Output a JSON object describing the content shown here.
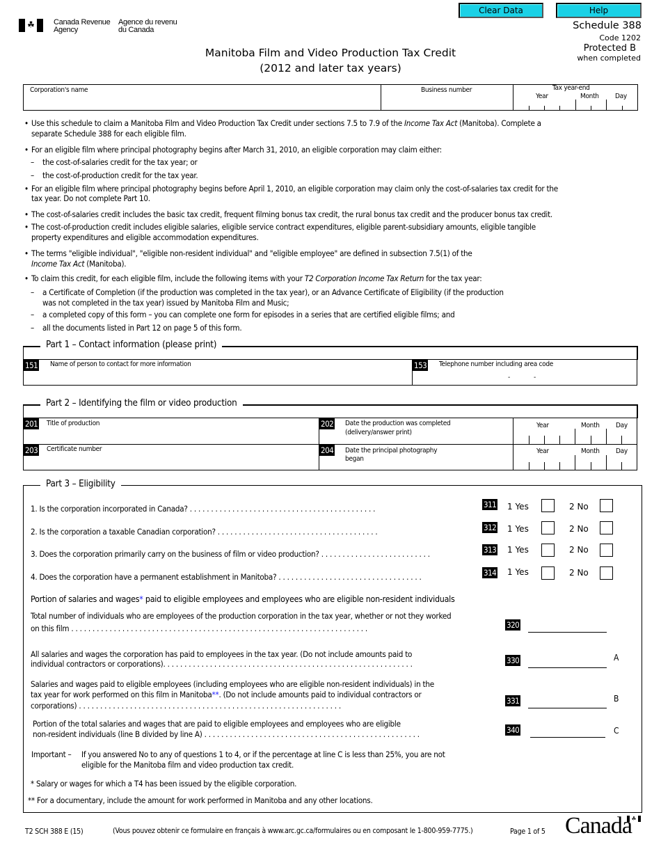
{
  "header": {
    "buttons": {
      "clear_data": "Clear Data",
      "help": "Help"
    },
    "agency_en": [
      "Canada Revenue",
      "Agency"
    ],
    "agency_fr": [
      "Agence du revenu",
      "du Canada"
    ],
    "flag_icon": "canada-flag-icon",
    "title": "Manitoba Film and Video Production Tax Credit",
    "subtitle": "(2012 and later tax years)",
    "schedule": "Schedule 388",
    "code": "Code 1202",
    "protected": "Protected B",
    "protected_note": "when completed"
  },
  "identification": {
    "corporation_name_label": "Corporation's name",
    "corporation_name_value": "",
    "business_number_label": "Business number",
    "business_number_value": "",
    "tax_year_end_label": "Tax year-end",
    "year_label": "Year",
    "month_label": "Month",
    "day_label": "Day"
  },
  "instructions": [
    {
      "type": "bullet",
      "lines": [
        "Use this schedule to claim a Manitoba Film and Video Production Tax Credit under sections 7.5 to 7.9 of the ",
        "Income Tax Act",
        " (Manitoba). Complete a",
        "separate Schedule 388 for each eligible film."
      ]
    },
    {
      "type": "bullet",
      "text": "For an eligible film where principal photography begins after March 31, 2010, an eligible corporation may claim either:"
    },
    {
      "type": "dash",
      "text": "the cost-of-salaries credit for the tax year; or"
    },
    {
      "type": "dash",
      "text": "the cost-of-production credit for the tax year."
    },
    {
      "type": "bullet",
      "lines": [
        "For an eligible film where principal photography begins before April 1, 2010, an eligible corporation may claim only the cost-of-salaries tax credit for the",
        "tax year. Do not complete Part 10."
      ]
    },
    {
      "type": "bullet",
      "text": "The cost-of-salaries credit includes the basic tax credit, frequent filming bonus tax credit, the rural bonus tax credit and the producer bonus tax credit."
    },
    {
      "type": "bullet",
      "lines": [
        "The cost-of-production credit includes eligible salaries, eligible service contract expenditures, eligible parent-subsidiary amounts, eligible tangible",
        "property expenditures and eligible accommodation expenditures."
      ]
    },
    {
      "type": "bullet",
      "lines": [
        "The terms \"eligible individual\", \"eligible non-resident individual\" and \"eligible employee\" are defined in subsection 7.5(1) of the",
        "Income Tax Act",
        " (Manitoba)."
      ]
    },
    {
      "type": "bullet",
      "lines": [
        "To claim this credit, for each eligible film, include the following items with your ",
        "T2 Corporation Income Tax Return",
        " for the tax year:"
      ]
    },
    {
      "type": "dash",
      "lines": [
        "a Certificate of Completion (if the production was completed in the tax year), or an Advance Certificate of Eligibility (if the production",
        "was not completed in the tax year) issued by Manitoba Film and Music;"
      ]
    },
    {
      "type": "dash",
      "text": "a completed copy of this form – you can complete one form for episodes in a series that are certified eligible films; and"
    },
    {
      "type": "dash",
      "text": "all the documents listed in Part 12 on page 5 of this form."
    }
  ],
  "part1": {
    "title": "Part 1 – Contact information (please print)",
    "fields": [
      {
        "code": "151",
        "label": "Name of person to contact for more information",
        "value": ""
      },
      {
        "code": "153",
        "label": "Telephone number including area code",
        "value": "",
        "separator": "-"
      }
    ]
  },
  "part2": {
    "title": "Part 2 – Identifying the film or video production",
    "fields": [
      {
        "code": "201",
        "label": "Title of production",
        "value": ""
      },
      {
        "code": "202",
        "label_lines": [
          "Date the production was completed",
          "(delivery/answer print)"
        ]
      },
      {
        "code": "203",
        "label": "Certificate number",
        "value": ""
      },
      {
        "code": "204",
        "label_lines": [
          "Date the principal photography",
          "began"
        ]
      }
    ],
    "year_label": "Year",
    "month_label": "Month",
    "day_label": "Day"
  },
  "part3": {
    "title": "Part 3 – Eligibility",
    "questions": [
      {
        "text": "1.  Is the corporation incorporated in Canada?",
        "code": "311",
        "yes": "1 Yes",
        "no": "2 No",
        "yes_checked": false,
        "no_checked": false
      },
      {
        "text": "2.  Is the corporation a taxable Canadian corporation?",
        "code": "312",
        "yes": "1 Yes",
        "no": "2 No",
        "yes_checked": false,
        "no_checked": false
      },
      {
        "text": "3.  Does the corporation primarily carry on the business of film or video production?",
        "code": "313",
        "yes": "1 Yes",
        "no": "2 No",
        "yes_checked": false,
        "no_checked": false
      },
      {
        "text": "4.  Does the corporation have a permanent establishment in Manitoba?",
        "code": "314",
        "yes": "1 Yes",
        "no": "2 No",
        "yes_checked": false,
        "no_checked": false
      }
    ],
    "portion_heading_a": "Portion of salaries and wages",
    "portion_heading_star": "*",
    "portion_heading_b": " paid to eligible employees and employees who are eligible non-resident individuals",
    "lines": [
      {
        "code": "320",
        "text_lines": [
          "Total number of individuals who are employees of the production corporation in the tax year, whether or not they worked",
          "on this film"
        ],
        "value": "",
        "letter": ""
      },
      {
        "code": "330",
        "text_lines": [
          "All salaries and wages the corporation has paid to employees in the tax year. (Do not include amounts paid to",
          "individual contractors or corporations)."
        ],
        "value": "",
        "letter": "A"
      },
      {
        "code": "331",
        "text_lines": [
          "Salaries and wages paid to eligible employees (including employees who are eligible non-resident individuals) in the",
          "tax year for work performed on this film in Manitoba",
          "**",
          ". (Do not include amounts paid to individual contractors or",
          "corporations)"
        ],
        "value": "",
        "letter": "B"
      },
      {
        "code": "340",
        "text_lines": [
          "Portion of the total salaries and wages that are paid to eligible employees and employees who are eligible",
          "non-resident individuals (line B divided by line A)"
        ],
        "value": "",
        "letter": "C"
      }
    ],
    "important_label": "Important –",
    "important_lines": [
      "If you answered No to any of questions 1 to 4, or if the percentage at line C is less than 25%, you are not",
      "eligible for the Manitoba film and video production tax credit."
    ],
    "footnote1": "*  Salary or wages for which a T4 has been issued by the eligible corporation.",
    "footnote2": "**  For a documentary, include the amount for work performed in Manitoba and any other locations."
  },
  "footer": {
    "form_id": "T2 SCH 388 E (15)",
    "french_note": "(Vous pouvez obtenir ce formulaire en français à www.arc.gc.ca/formulaires ou en composant le 1-800-959-7775.)",
    "page": "Page 1 of 5",
    "wordmark": "Canadä"
  },
  "colors": {
    "button_bg": "#1ad1e6",
    "footnote_star": "#1a1aff"
  }
}
